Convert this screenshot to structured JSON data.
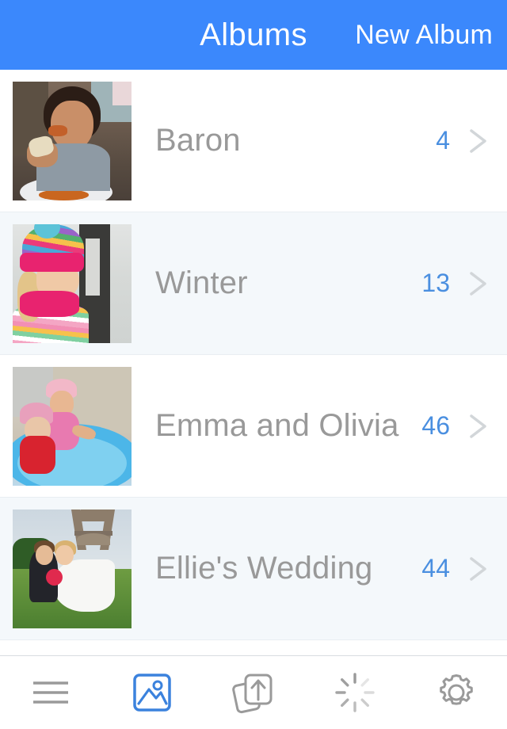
{
  "header": {
    "title": "Albums",
    "action_label": "New Album",
    "background_color": "#3b88fc",
    "text_color": "#ffffff"
  },
  "colors": {
    "accent_blue": "#3b88fc",
    "count_blue": "#4a8fe0",
    "title_grey": "#999999",
    "row_alt_background": "#f4f8fb",
    "divider": "#e9eef2",
    "icon_grey": "#9a9a9a",
    "icon_active_blue": "#3b82dd"
  },
  "albums": [
    {
      "name": "Baron",
      "count": "4",
      "thumbnail": "child-eating-photo",
      "chevron": "chevron-right-icon",
      "row_style": "plain"
    },
    {
      "name": "Winter",
      "count": "13",
      "thumbnail": "girl-winter-hat-photo",
      "chevron": "chevron-right-icon",
      "row_style": "alt"
    },
    {
      "name": "Emma and Olivia",
      "count": "46",
      "thumbnail": "girls-paddling-pool-photo",
      "chevron": "chevron-right-icon",
      "row_style": "plain"
    },
    {
      "name": "Ellie's Wedding",
      "count": "44",
      "thumbnail": "wedding-couple-eiffel-tower-photo",
      "chevron": "chevron-right-icon",
      "row_style": "alt"
    }
  ],
  "toolbar": {
    "items": [
      {
        "icon": "hamburger-menu-icon",
        "label": "menu",
        "active": false
      },
      {
        "icon": "photo-library-icon",
        "label": "photos",
        "active": true
      },
      {
        "icon": "upload-icon",
        "label": "upload",
        "active": false
      },
      {
        "icon": "spinner-icon",
        "label": "activity",
        "active": false
      },
      {
        "icon": "gear-icon",
        "label": "settings",
        "active": false
      }
    ]
  }
}
